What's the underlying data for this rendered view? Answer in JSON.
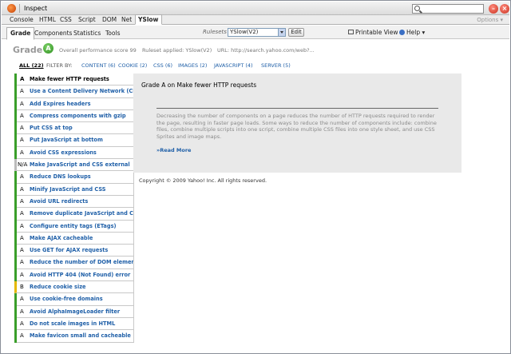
{
  "firebug": {
    "inspect_label": "Inspect",
    "tabs": [
      "Console",
      "HTML",
      "CSS",
      "Script",
      "DOM",
      "Net",
      "YSlow"
    ],
    "active_tab": "YSlow",
    "options_label": "Options ▾",
    "search_value": ""
  },
  "yslow": {
    "tabs": [
      "Grade",
      "Components",
      "Statistics",
      "Tools"
    ],
    "active_tab": "Grade",
    "rulesets_label": "Rulesets",
    "rulesets_selected": "YSlow(V2)",
    "edit_label": "Edit",
    "printable_label": "Printable View",
    "help_label": "Help ▾"
  },
  "grade": {
    "title": "Grade",
    "letter": "A",
    "overall": "Overall performance score 99",
    "ruleset": "Ruleset applied: YSlow(V2)",
    "url": "URL: http://search.yahoo.com/web?..."
  },
  "filters": {
    "all": "ALL (22)",
    "label": "FILTER BY:",
    "items": [
      "CONTENT (6)",
      "COOKIE (2)",
      "CSS (6)",
      "IMAGES (2)",
      "JAVASCRIPT (4)",
      "SERVER (5)"
    ]
  },
  "rules": [
    {
      "grade": "A",
      "title": "Make fewer HTTP requests"
    },
    {
      "grade": "A",
      "title": "Use a Content Delivery Network (CDN)"
    },
    {
      "grade": "A",
      "title": "Add Expires headers"
    },
    {
      "grade": "A",
      "title": "Compress components with gzip"
    },
    {
      "grade": "A",
      "title": "Put CSS at top"
    },
    {
      "grade": "A",
      "title": "Put JavaScript at bottom"
    },
    {
      "grade": "A",
      "title": "Avoid CSS expressions"
    },
    {
      "grade": "N/A",
      "title": "Make JavaScript and CSS external"
    },
    {
      "grade": "A",
      "title": "Reduce DNS lookups"
    },
    {
      "grade": "A",
      "title": "Minify JavaScript and CSS"
    },
    {
      "grade": "A",
      "title": "Avoid URL redirects"
    },
    {
      "grade": "A",
      "title": "Remove duplicate JavaScript and CSS"
    },
    {
      "grade": "A",
      "title": "Configure entity tags (ETags)"
    },
    {
      "grade": "A",
      "title": "Make AJAX cacheable"
    },
    {
      "grade": "A",
      "title": "Use GET for AJAX requests"
    },
    {
      "grade": "A",
      "title": "Reduce the number of DOM elements"
    },
    {
      "grade": "A",
      "title": "Avoid HTTP 404 (Not Found) error"
    },
    {
      "grade": "B",
      "title": "Reduce cookie size"
    },
    {
      "grade": "A",
      "title": "Use cookie-free domains"
    },
    {
      "grade": "A",
      "title": "Avoid AlphaImageLoader filter"
    },
    {
      "grade": "A",
      "title": "Do not scale images in HTML"
    },
    {
      "grade": "A",
      "title": "Make favicon small and cacheable"
    }
  ],
  "detail": {
    "title": "Grade A on Make fewer HTTP requests",
    "text": "Decreasing the number of components on a page reduces the number of HTTP requests required to render the page, resulting in faster page loads. Some ways to reduce the number of components include: combine files, combine multiple scripts into one script, combine multiple CSS files into one style sheet, and use CSS Sprites and image maps.",
    "read_more": "»Read More"
  },
  "copyright": "Copyright © 2009 Yahoo! Inc. All rights reserved.",
  "colors": {
    "grade_a": "#3a9e2a",
    "grade_b": "#e6b800",
    "link": "#2060a8"
  }
}
